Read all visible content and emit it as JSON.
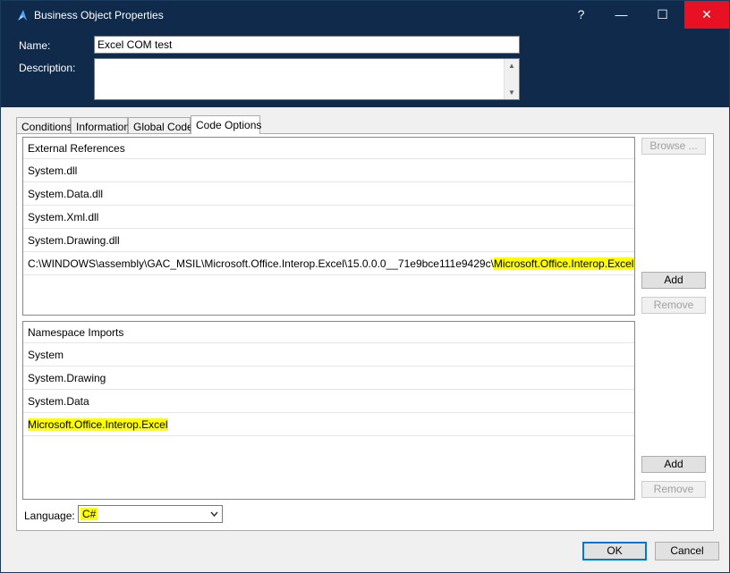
{
  "window": {
    "title": "Business Object Properties",
    "help_glyph": "?",
    "minimize_glyph": "—",
    "maximize_glyph": "☐",
    "close_glyph": "✕"
  },
  "form": {
    "name_label": "Name:",
    "name_value": "Excel COM test",
    "description_label": "Description:",
    "description_value": ""
  },
  "tabs": [
    {
      "label": "Conditions",
      "active": false
    },
    {
      "label": "Information",
      "active": false
    },
    {
      "label": "Global Code",
      "active": false
    },
    {
      "label": "Code Options",
      "active": true
    }
  ],
  "external_references": {
    "header": "External References",
    "items": [
      {
        "prefix": "System.dll",
        "highlight": ""
      },
      {
        "prefix": "System.Data.dll",
        "highlight": ""
      },
      {
        "prefix": "System.Xml.dll",
        "highlight": ""
      },
      {
        "prefix": "System.Drawing.dll",
        "highlight": ""
      },
      {
        "prefix": "C:\\WINDOWS\\assembly\\GAC_MSIL\\Microsoft.Office.Interop.Excel\\15.0.0.0__71e9bce111e9429c\\",
        "highlight": "Microsoft.Office.Interop.Excel.dll"
      }
    ],
    "browse_label": "Browse ...",
    "add_label": "Add",
    "remove_label": "Remove"
  },
  "namespace_imports": {
    "header": "Namespace Imports",
    "items": [
      {
        "prefix": "System",
        "highlight": ""
      },
      {
        "prefix": "System.Drawing",
        "highlight": ""
      },
      {
        "prefix": "System.Data",
        "highlight": ""
      },
      {
        "prefix": "",
        "highlight": "Microsoft.Office.Interop.Excel"
      }
    ],
    "add_label": "Add",
    "remove_label": "Remove"
  },
  "language": {
    "label": "Language:",
    "value": "C#"
  },
  "footer": {
    "ok_label": "OK",
    "cancel_label": "Cancel"
  },
  "colors": {
    "titlebar": "#0f2a4a",
    "close_button": "#e81123",
    "highlight": "#ffff00"
  }
}
